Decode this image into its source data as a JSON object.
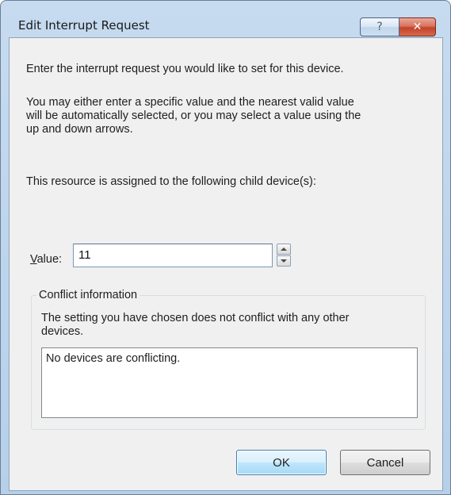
{
  "window": {
    "title": "Edit Interrupt Request",
    "help_glyph": "?",
    "close_glyph": "✕"
  },
  "body": {
    "intro": "Enter the interrupt request you would like to set for this device.",
    "instructions_line1": "You may either enter a specific value and the nearest valid value",
    "instructions_line2": "will be automatically selected, or you may select a value using the",
    "instructions_line3": "up and down arrows.",
    "assigned_text": "This resource is assigned to the following child device(s):"
  },
  "value_field": {
    "label_accel": "V",
    "label_rest": "alue:",
    "value": "11"
  },
  "conflict": {
    "group_title": "Conflict information",
    "message_line1": "The setting you have chosen does not conflict with any other",
    "message_line2": "devices.",
    "list_text": "No devices are conflicting."
  },
  "buttons": {
    "ok": "OK",
    "cancel": "Cancel"
  },
  "colors": {
    "title_bar": "#c6dbef",
    "close_button": "#c4412a",
    "ok_border": "#3c7fb1"
  }
}
